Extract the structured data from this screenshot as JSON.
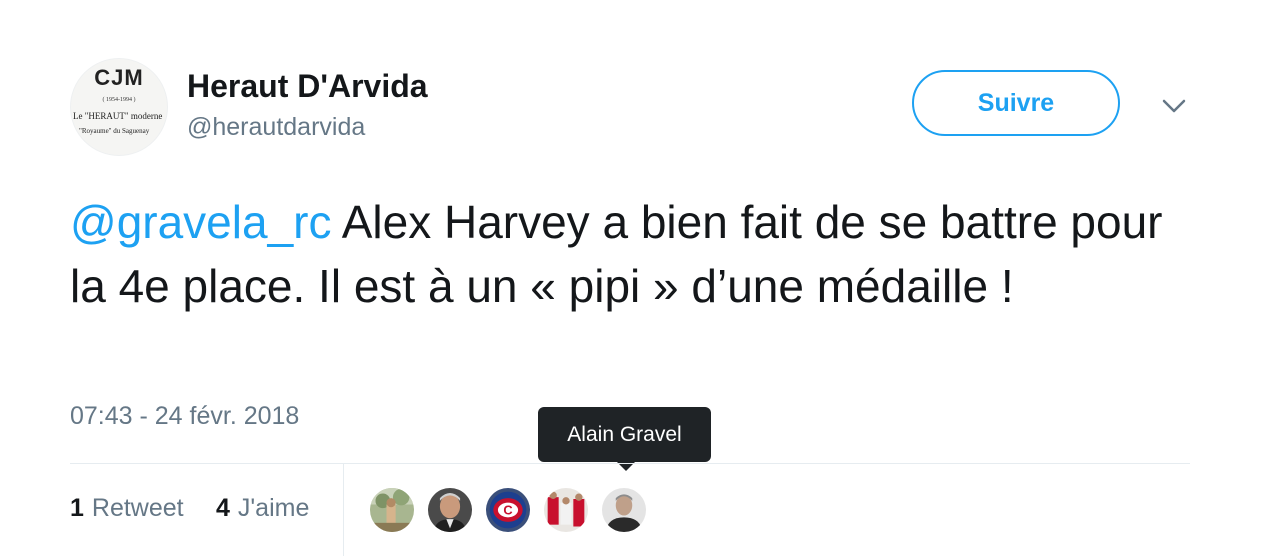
{
  "account": {
    "display_name": "Heraut D'Arvida",
    "handle": "@herautdarvida",
    "avatar_logo": {
      "title": "CJM",
      "years": "( 1954-1994 )",
      "line1": "Le \"HERAUT\" moderne",
      "line2": "\"Royaume\" du Saguenay"
    }
  },
  "header": {
    "follow_label": "Suivre",
    "menu_icon": "chevron-down-icon"
  },
  "tweet": {
    "mention": "@gravela_rc",
    "text": " Alex Harvey a bien fait de se battre pour la 4e place. Il est à un « pipi » d’une médaille !",
    "timestamp": "07:43 - 24 févr. 2018"
  },
  "stats": {
    "retweets_count": "1",
    "retweets_label": "Retweet",
    "likes_count": "4",
    "likes_label": "J'aime"
  },
  "likers": {
    "tooltip": "Alain Gravel",
    "avatars": [
      "outdoor-photo-avatar",
      "man-portrait-avatar",
      "canadiens-logo-avatar",
      "hockey-players-avatar",
      "alain-gravel-avatar"
    ]
  },
  "colors": {
    "accent": "#1da1f2",
    "text": "#14171a",
    "muted": "#657786",
    "tooltip_bg": "#1f2326",
    "divider": "#e6ecf0"
  }
}
